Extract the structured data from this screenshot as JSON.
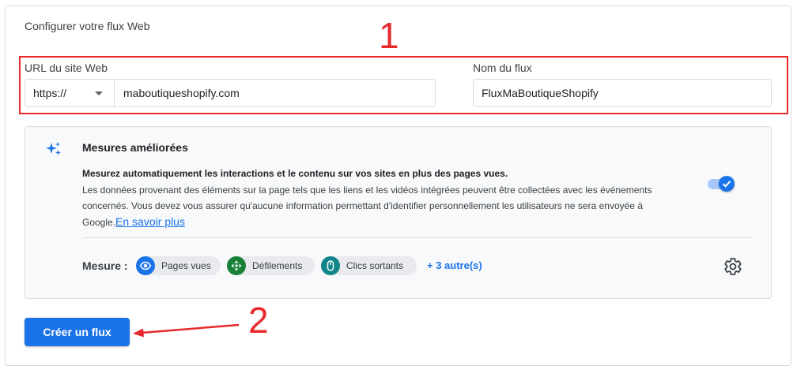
{
  "panel": {
    "title": "Configurer votre flux Web"
  },
  "annotations": {
    "step1": "1",
    "step2": "2",
    "color": "#e8292c"
  },
  "url_field": {
    "label": "URL du site Web",
    "protocol": "https://",
    "value": "maboutiqueshopify.com"
  },
  "name_field": {
    "label": "Nom du flux",
    "value": "FluxMaBoutiqueShopify"
  },
  "enhanced": {
    "title": "Mesures améliorées",
    "desc_bold": "Mesurez automatiquement les interactions et le contenu sur vos sites en plus des pages vues.",
    "desc": "Les données provenant des éléments sur la page tels que les liens et les vidéos intégrées peuvent être collectées avec les événements concernés. Vous devez vous assurer qu'aucune information permettant d'identifier personnellement les utilisateurs ne sera envoyée à Google.",
    "learn_more": "En savoir plus",
    "toggle_on": true
  },
  "measures": {
    "label": "Mesure :",
    "chips": [
      {
        "label": "Pages vues",
        "icon": "eye-icon"
      },
      {
        "label": "Défilements",
        "icon": "scroll-icon"
      },
      {
        "label": "Clics sortants",
        "icon": "mouse-icon"
      }
    ],
    "more": "+ 3 autre(s)"
  },
  "actions": {
    "create": "Créer un flux"
  },
  "colors": {
    "primary": "#1a73e8",
    "border": "#dadce0",
    "card_bg": "#f8f9fa"
  }
}
